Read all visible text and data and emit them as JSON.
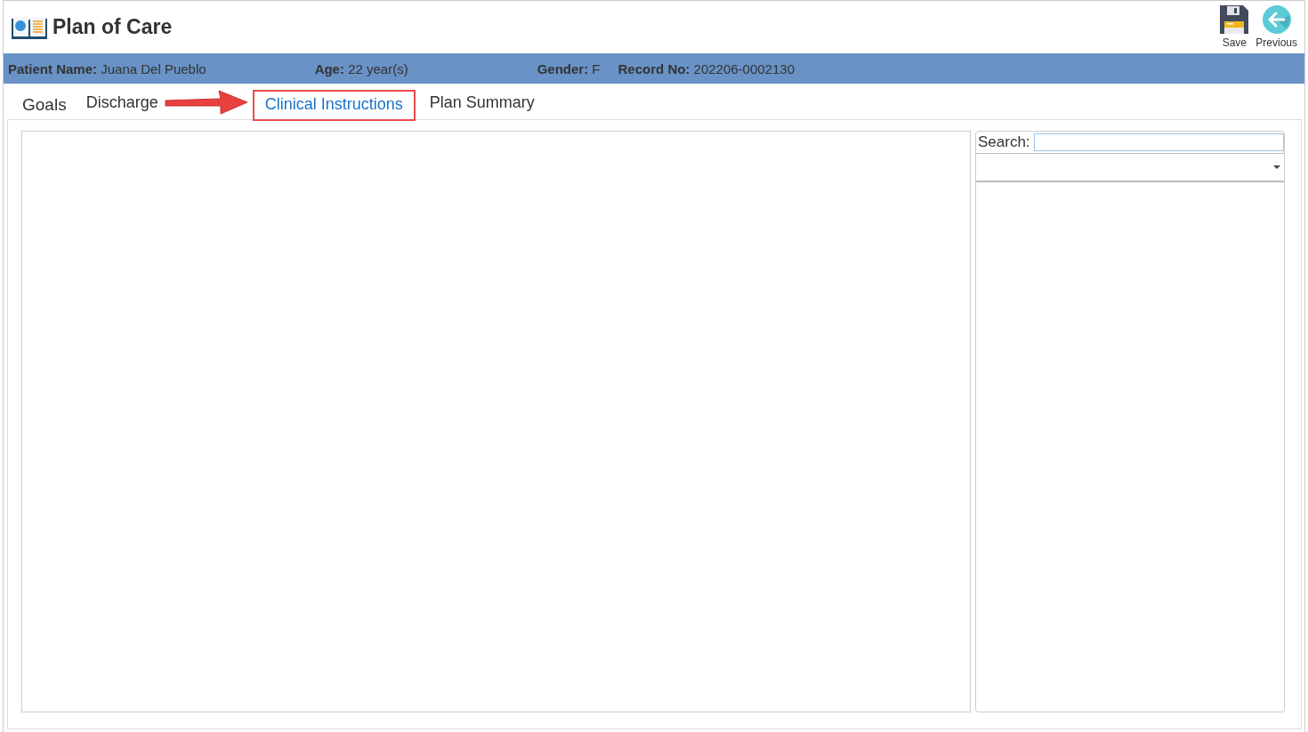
{
  "window": {
    "title": "Plan of Care"
  },
  "toolbar": [
    {
      "label": "Save",
      "kind": "save"
    },
    {
      "label": "Previous",
      "kind": "previous"
    }
  ],
  "patient_bar": [
    {
      "label": "Patient Name:",
      "value": "Juana Del Pueblo"
    },
    {
      "label": "Age:",
      "value": "22 year(s)"
    },
    {
      "label": "Gender:",
      "value": "F"
    },
    {
      "label": "Record No:",
      "value": "202206-0002130"
    }
  ],
  "tabs": [
    {
      "label": "Goals",
      "selected": false,
      "highlighted": false
    },
    {
      "label": "Discharge",
      "selected": false,
      "highlighted": false
    },
    {
      "label": "Clinical Instructions",
      "selected": true,
      "highlighted": true
    },
    {
      "label": "Plan Summary",
      "selected": false,
      "highlighted": false
    }
  ],
  "search": {
    "label": "Search:"
  }
}
